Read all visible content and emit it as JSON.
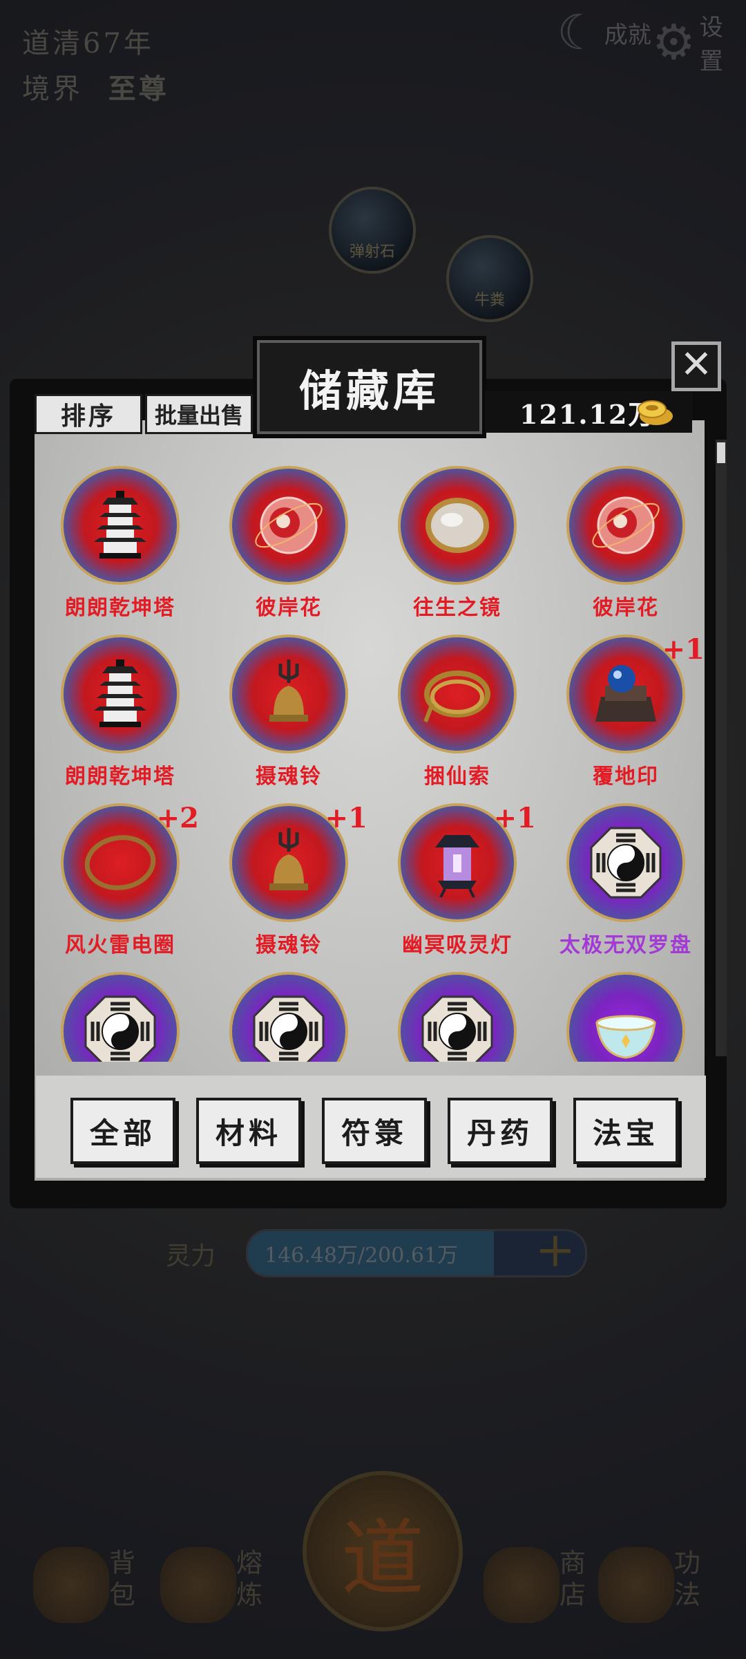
{
  "hud": {
    "age": "道清67年",
    "realm_label": "境界",
    "realm_value": "至尊",
    "achievements_label": "成就",
    "settings_label": "设置"
  },
  "bubbles": [
    {
      "label": "弹射石"
    },
    {
      "label": "牛粪"
    }
  ],
  "storage": {
    "title": "储藏库",
    "sort_label": "排序",
    "batch_sell_label": "批量出售",
    "currency_value": "121.12万",
    "items": [
      {
        "name": "朗朗乾坤塔",
        "icon": "pagoda-icon",
        "plus": "",
        "rarity": "red"
      },
      {
        "name": "彼岸花",
        "icon": "orb-flower-icon",
        "plus": "",
        "rarity": "red"
      },
      {
        "name": "往生之镜",
        "icon": "mirror-icon",
        "plus": "",
        "rarity": "red"
      },
      {
        "name": "彼岸花",
        "icon": "orb-flower-icon",
        "plus": "",
        "rarity": "red"
      },
      {
        "name": "朗朗乾坤塔",
        "icon": "pagoda-icon",
        "plus": "",
        "rarity": "red"
      },
      {
        "name": "摄魂铃",
        "icon": "bell-icon",
        "plus": "",
        "rarity": "red"
      },
      {
        "name": "捆仙索",
        "icon": "rope-icon",
        "plus": "",
        "rarity": "red"
      },
      {
        "name": "覆地印",
        "icon": "seal-icon",
        "plus": "+1",
        "rarity": "red"
      },
      {
        "name": "风火雷电圈",
        "icon": "ring-icon",
        "plus": "+2",
        "rarity": "red"
      },
      {
        "name": "摄魂铃",
        "icon": "bell-icon",
        "plus": "+1",
        "rarity": "red"
      },
      {
        "name": "幽冥吸灵灯",
        "icon": "lantern-icon",
        "plus": "+1",
        "rarity": "red"
      },
      {
        "name": "太极无双罗盘",
        "icon": "taiji-compass-icon",
        "plus": "",
        "rarity": "purple"
      },
      {
        "name": "",
        "icon": "taiji-compass-icon",
        "plus": "",
        "rarity": "purple"
      },
      {
        "name": "",
        "icon": "taiji-compass-icon",
        "plus": "",
        "rarity": "purple"
      },
      {
        "name": "",
        "icon": "taiji-compass-icon",
        "plus": "",
        "rarity": "purple"
      },
      {
        "name": "",
        "icon": "bowl-icon",
        "plus": "",
        "rarity": "purple"
      }
    ],
    "tabs": [
      "全部",
      "材料",
      "符箓",
      "丹药",
      "法宝"
    ]
  },
  "spirit": {
    "label": "灵力",
    "value": "146.48万/200.61万",
    "fill_fraction": 0.73
  },
  "center_button": "道",
  "bottom_nav": [
    {
      "label": "背包",
      "icon": "bag-icon"
    },
    {
      "label": "熔炼",
      "icon": "furnace-icon"
    },
    {
      "label": "商店",
      "icon": "scroll-icon"
    },
    {
      "label": "功法",
      "icon": "book-icon"
    }
  ],
  "colors": {
    "item_name_red": "#e31b24",
    "item_name_purple": "#a43ad6"
  }
}
